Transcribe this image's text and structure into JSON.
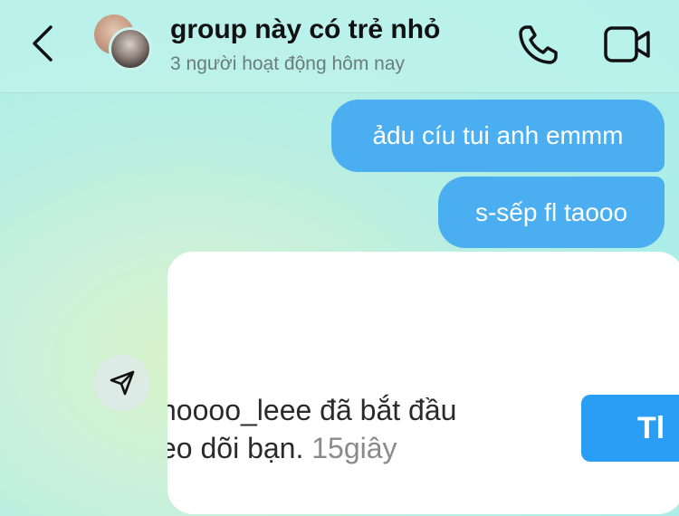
{
  "header": {
    "back_icon": "chevron-left-icon",
    "title": "group này có trẻ nhỏ",
    "subtitle": "3 người hoạt động hôm nay",
    "call_icon": "phone-icon",
    "video_icon": "video-camera-icon"
  },
  "messages": [
    {
      "text": "ảdu cíu tui anh emmm"
    },
    {
      "text": "s-sếp fl taooo"
    }
  ],
  "shared_post": {
    "notification_user": "noooo_leee",
    "notification_text_line1_suffix": " đã bắt đầu",
    "notification_text_line2": "eo dõi bạn. ",
    "notification_time": "15giây",
    "follow_button_label": "Tl",
    "share_icon": "send-icon"
  },
  "colors": {
    "bubble": "#4aaef0",
    "follow_button": "#2a9df4"
  }
}
